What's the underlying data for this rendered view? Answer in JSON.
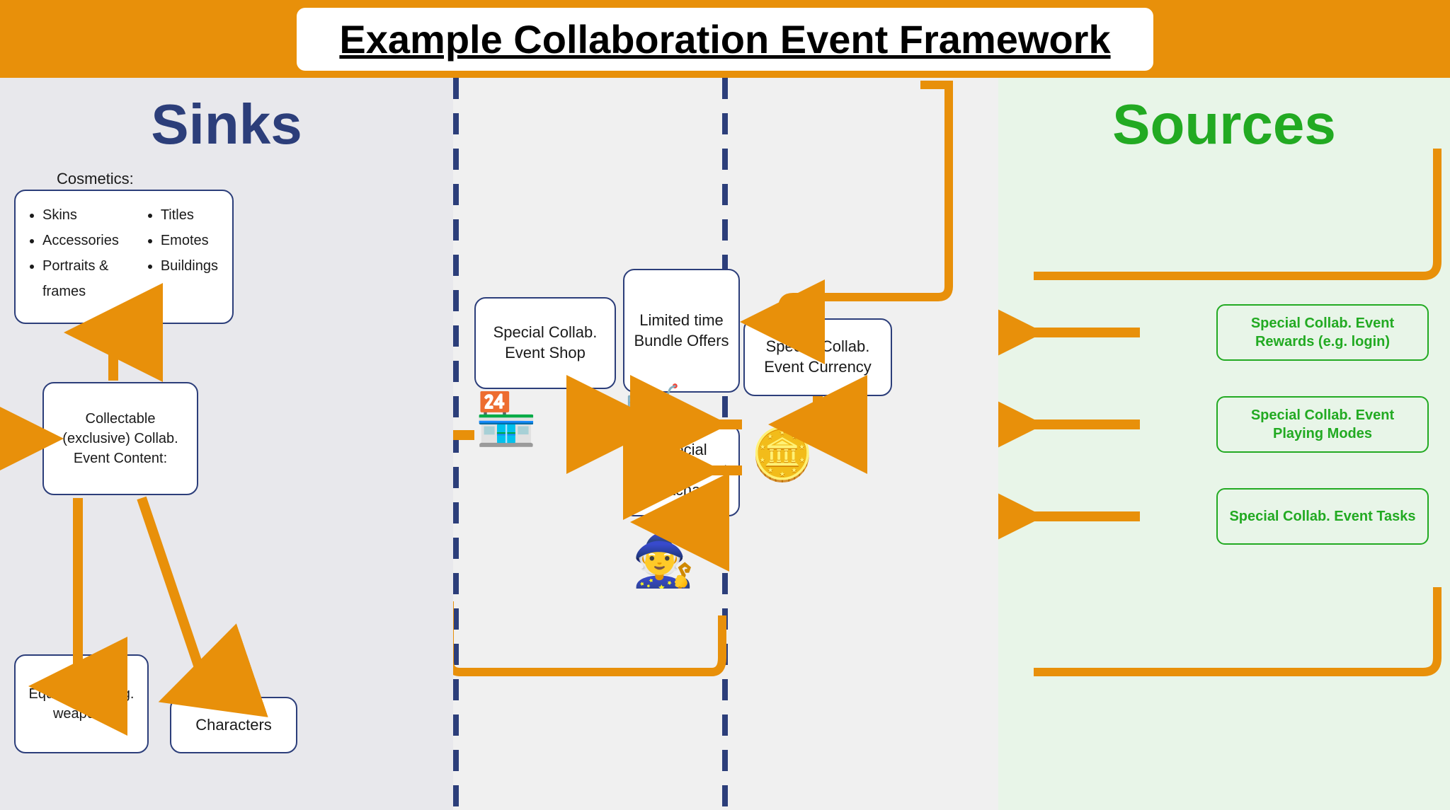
{
  "header": {
    "title": "Example Collaboration Event Framework"
  },
  "sinks": {
    "title": "Sinks",
    "cosmetics_label": "Cosmetics:",
    "cosmetics_col1": [
      "Skins",
      "Accessories",
      "Portraits & frames"
    ],
    "cosmetics_col2": [
      "Titles",
      "Emotes",
      "Buildings"
    ],
    "collectable_box": "Collectable (exclusive) Collab. Event Content:",
    "equip_box": "Equip. items e.g. weapons",
    "characters_box": "Characters"
  },
  "middle": {
    "special_event_shop": "Special Collab. Event Shop",
    "limited_bundle": "Limited time Bundle Offers",
    "special_gacha": "Special Collab. Event Gachas",
    "special_currency": "Special Collab. Event Currency"
  },
  "sources": {
    "title": "Sources",
    "reward_box": "Special Collab. Event Rewards (e.g. login)",
    "playing_box": "Special Collab. Event Playing Modes",
    "tasks_box": "Special Collab. Event Tasks"
  }
}
